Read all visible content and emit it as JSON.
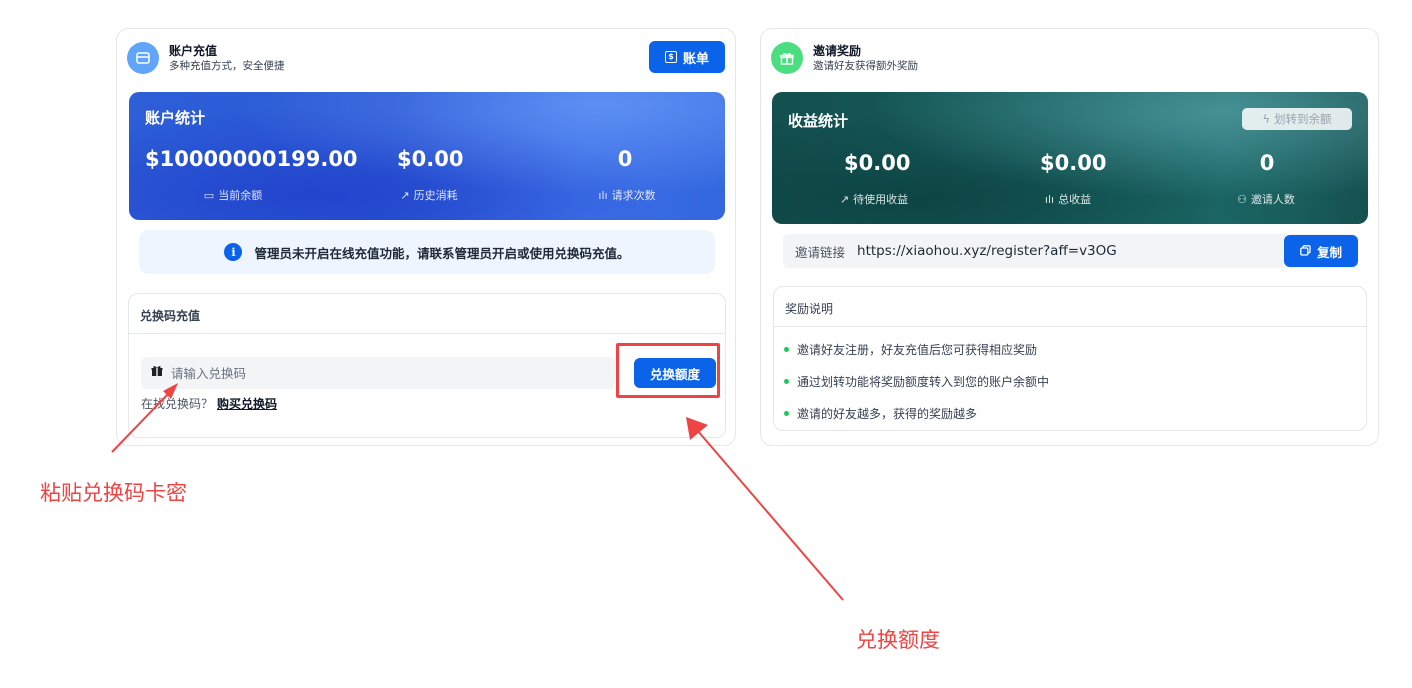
{
  "recharge": {
    "title": "账户充值",
    "subtitle": "多种充值方式，安全便捷",
    "bill_button": "账单",
    "stats": {
      "title": "账户统计",
      "balance_value": "$10000000199.00",
      "balance_label": "当前余额",
      "consumed_value": "$0.00",
      "consumed_label": "历史消耗",
      "requests_value": "0",
      "requests_label": "请求次数"
    },
    "notice": "管理员未开启在线充值功能，请联系管理员开启或使用兑换码充值。",
    "redeem": {
      "title": "兑换码充值",
      "input_placeholder": "请输入兑换码",
      "button": "兑换额度",
      "no_code_text": "在找兑换码？",
      "buy_link": "购买兑换码"
    }
  },
  "invite": {
    "title": "邀请奖励",
    "subtitle": "邀请好友获得额外奖励",
    "stats": {
      "title": "收益统计",
      "transfer_button": "划转到余额",
      "pending_value": "$0.00",
      "pending_label": "待使用收益",
      "total_value": "$0.00",
      "total_label": "总收益",
      "invited_value": "0",
      "invited_label": "邀请人数"
    },
    "link_label": "邀请链接",
    "link_url": "https://xiaohou.xyz/register?aff=v3OG",
    "copy_button": "复制",
    "rules_title": "奖励说明",
    "rules": [
      "邀请好友注册，好友充值后您可获得相应奖励",
      "通过划转功能将奖励额度转入到您的账户余额中",
      "邀请的好友越多，获得的奖励越多"
    ]
  },
  "annotations": {
    "paste": "粘贴兑换码卡密",
    "redeem": "兑换额度",
    "color": "#ef4444"
  },
  "colors": {
    "primary": "#0a63e9",
    "stats_blue": "#2d5fd8",
    "stats_teal": "#165e5d"
  }
}
